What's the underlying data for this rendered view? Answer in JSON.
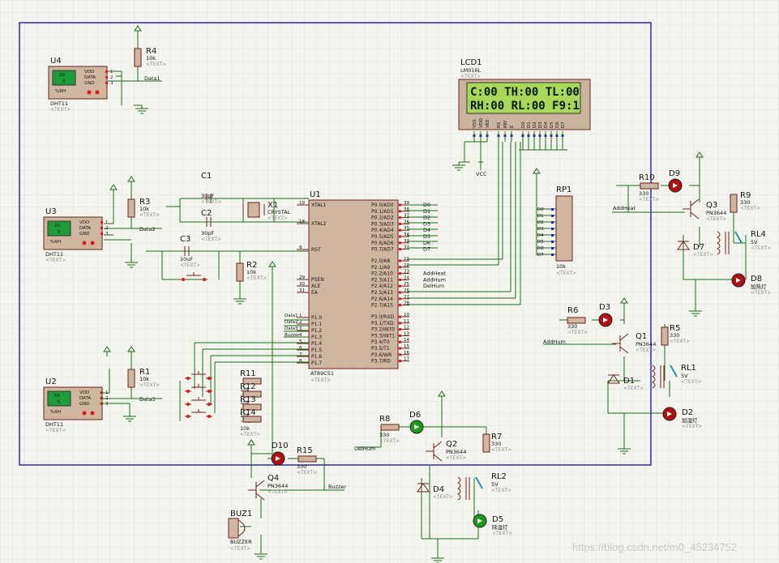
{
  "watermark": "https://blog.csdn.net/m0_45234752",
  "lcd": {
    "ref": "LCD1",
    "model": "LM016L",
    "text_tag": "<TEXT>",
    "line1": "C:00 TH:00 TL:00",
    "line2": "RH:00 RL:00 F9:1",
    "pins": [
      "VSS",
      "VDD",
      "VEE",
      "RS",
      "RW",
      "E",
      "D0",
      "D1",
      "D2",
      "D3",
      "D4",
      "D5",
      "D6",
      "D7"
    ],
    "vcc": "VCC"
  },
  "mcu": {
    "ref": "U1",
    "model": "AT89C51",
    "text_tag": "<TEXT>",
    "left_pins": [
      {
        "num": "19",
        "name": "XTAL1"
      },
      {
        "num": "18",
        "name": "XTAL2"
      },
      {
        "num": "9",
        "name": "RST"
      },
      {
        "num": "29",
        "name": "PSEN"
      },
      {
        "num": "30",
        "name": "ALE"
      },
      {
        "num": "31",
        "name": "EA"
      },
      {
        "num": "1",
        "name": "P1.0",
        "net": "Data1"
      },
      {
        "num": "2",
        "name": "P1.1",
        "net": "Data2"
      },
      {
        "num": "3",
        "name": "P1.2",
        "net": "Data3"
      },
      {
        "num": "4",
        "name": "P1.3",
        "net": "Buzzer"
      },
      {
        "num": "5",
        "name": "P1.4"
      },
      {
        "num": "6",
        "name": "P1.5"
      },
      {
        "num": "7",
        "name": "P1.6"
      },
      {
        "num": "8",
        "name": "P1.7"
      }
    ],
    "right_pins": [
      {
        "num": "39",
        "name": "P0.0/AD0",
        "net": "D0"
      },
      {
        "num": "38",
        "name": "P0.1/AD1",
        "net": "D1"
      },
      {
        "num": "37",
        "name": "P0.2/AD2",
        "net": "D2"
      },
      {
        "num": "36",
        "name": "P0.3/AD3",
        "net": "D3"
      },
      {
        "num": "35",
        "name": "P0.4/AD4",
        "net": "D4"
      },
      {
        "num": "34",
        "name": "P0.5/AD5",
        "net": "D5"
      },
      {
        "num": "33",
        "name": "P0.6/AD6",
        "net": "D6"
      },
      {
        "num": "32",
        "name": "P0.7/AD7",
        "net": "D7"
      },
      {
        "num": "21",
        "name": "P2.0/A8"
      },
      {
        "num": "22",
        "name": "P2.1/A9"
      },
      {
        "num": "23",
        "name": "P2.2/A10",
        "net": "AddHeat"
      },
      {
        "num": "24",
        "name": "P2.3/A11",
        "net": "AddHum"
      },
      {
        "num": "25",
        "name": "P2.4/A12",
        "net": "DelHum"
      },
      {
        "num": "26",
        "name": "P2.5/A13"
      },
      {
        "num": "27",
        "name": "P2.6/A14"
      },
      {
        "num": "28",
        "name": "P2.7/A15"
      },
      {
        "num": "10",
        "name": "P3.0/RXD"
      },
      {
        "num": "11",
        "name": "P3.1/TXD"
      },
      {
        "num": "12",
        "name": "P3.2/INT0"
      },
      {
        "num": "13",
        "name": "P3.3/INT1"
      },
      {
        "num": "14",
        "name": "P3.4/T0"
      },
      {
        "num": "15",
        "name": "P3.5/T1"
      },
      {
        "num": "16",
        "name": "P3.6/WR"
      },
      {
        "num": "17",
        "name": "P3.7/RD"
      }
    ]
  },
  "sensors": [
    {
      "ref": "U4",
      "model": "DHT11",
      "lcd_top": "20",
      "lcd_bot": "5",
      "net": "Data1"
    },
    {
      "ref": "U3",
      "model": "DHT11",
      "lcd_top": "20",
      "lcd_bot": "5",
      "net": "Data2"
    },
    {
      "ref": "U2",
      "model": "DHT11",
      "lcd_top": "55",
      "lcd_bot": "5",
      "net": "Data3"
    }
  ],
  "sensor_pins": [
    "VDD",
    "DATA",
    "GND"
  ],
  "sensor_unit": "%RH",
  "resistors": [
    {
      "ref": "R4",
      "value": "10k"
    },
    {
      "ref": "R3",
      "value": "10k"
    },
    {
      "ref": "R1",
      "value": "10k"
    },
    {
      "ref": "R2",
      "value": "10k"
    },
    {
      "ref": "R10",
      "value": "330"
    },
    {
      "ref": "R9",
      "value": "330"
    },
    {
      "ref": "R6",
      "value": "330"
    },
    {
      "ref": "R5",
      "value": "330"
    },
    {
      "ref": "R8",
      "value": "330"
    },
    {
      "ref": "R7",
      "value": "330"
    },
    {
      "ref": "R15",
      "value": "330"
    },
    {
      "ref": "R11",
      "value": "10k"
    },
    {
      "ref": "R12",
      "value": "10k"
    },
    {
      "ref": "R13",
      "value": "10k"
    },
    {
      "ref": "R14",
      "value": "10k"
    }
  ],
  "capacitors": [
    {
      "ref": "C1",
      "value": "30pF"
    },
    {
      "ref": "C2",
      "value": "30pF"
    },
    {
      "ref": "C3",
      "value": "10uF"
    }
  ],
  "crystal": {
    "ref": "X1",
    "value": "CRYSTAL"
  },
  "rp1": {
    "ref": "RP1",
    "value": "10k",
    "nets": [
      "D0",
      "D1",
      "D2",
      "D3",
      "D4",
      "D5",
      "D6",
      "D7"
    ]
  },
  "transistors": [
    {
      "ref": "Q3",
      "model": "PN3644"
    },
    {
      "ref": "Q1",
      "model": "PN3644"
    },
    {
      "ref": "Q2",
      "model": "PN3644"
    },
    {
      "ref": "Q4",
      "model": "PN3644"
    }
  ],
  "diodes": [
    {
      "ref": "D7"
    },
    {
      "ref": "D1"
    },
    {
      "ref": "D4"
    }
  ],
  "leds": [
    {
      "ref": "D9"
    },
    {
      "ref": "D8",
      "label": "加热灯"
    },
    {
      "ref": "D3"
    },
    {
      "ref": "D2",
      "label": "加湿灯"
    },
    {
      "ref": "D6"
    },
    {
      "ref": "D5",
      "label": "除湿灯"
    },
    {
      "ref": "D10"
    }
  ],
  "relays": [
    {
      "ref": "RL4",
      "value": "5V"
    },
    {
      "ref": "RL1",
      "value": "5V"
    },
    {
      "ref": "RL2",
      "value": "5V"
    }
  ],
  "buzzer": {
    "ref": "BUZ1",
    "model": "BUZZER"
  },
  "nets": {
    "addheat": "AddHeat",
    "addhum": "AddHum",
    "delhum": "DelHum",
    "buzzer": "Buzzer"
  },
  "text_tag": "<TEXT>",
  "colors": {
    "wire": "#1a6b1a",
    "component": "#6e2020",
    "component_fill": "#cfb79f",
    "lcd_screen": "#a8d85a",
    "led_red": "#b01010",
    "led_green": "#1c9c1c",
    "border": "#1b1bb0",
    "grid": "#d2d2d2"
  }
}
